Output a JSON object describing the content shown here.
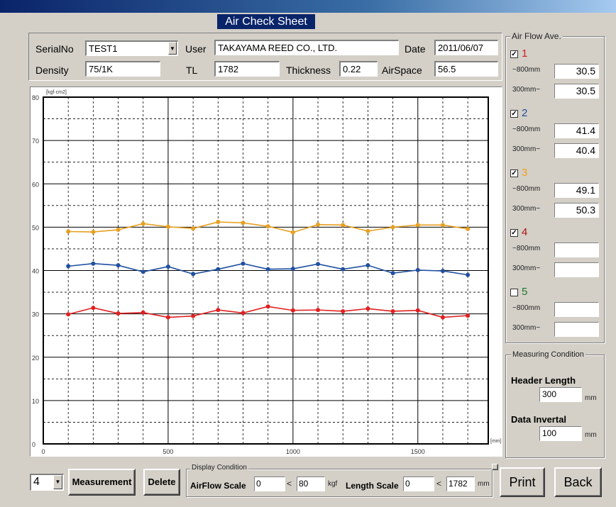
{
  "window": {
    "title": "Air Check Sheet"
  },
  "header": {
    "serial_label": "SerialNo",
    "serial_value": "TEST1",
    "user_label": "User",
    "user_value": "TAKAYAMA REED CO., LTD.",
    "date_label": "Date",
    "date_value": "2011/06/07",
    "density_label": "Density",
    "density_value": "75/1K",
    "tl_label": "TL",
    "tl_value": "1782",
    "thickness_label": "Thickness",
    "thickness_value": "0.22",
    "airspace_label": "AirSpace",
    "airspace_value": "56.5"
  },
  "airflow": {
    "title": "Air Flow Ave.",
    "row1_label": "~800mm",
    "row2_label": "300mm~",
    "groups": [
      {
        "num": "1",
        "checked": true,
        "color": "#d01c1c",
        "v1": "30.5",
        "v2": "30.5"
      },
      {
        "num": "2",
        "checked": true,
        "color": "#1f4ea0",
        "v1": "41.4",
        "v2": "40.4"
      },
      {
        "num": "3",
        "checked": true,
        "color": "#f0a020",
        "v1": "49.1",
        "v2": "50.3"
      },
      {
        "num": "4",
        "checked": true,
        "color": "#b01010",
        "v1": "",
        "v2": ""
      },
      {
        "num": "5",
        "checked": false,
        "color": "#1a7a2a",
        "v1": "",
        "v2": ""
      }
    ]
  },
  "measuring": {
    "title": "Measuring Condition",
    "header_length_label": "Header Length",
    "header_length_value": "300",
    "header_length_unit": "mm",
    "data_interval_label": "Data Invertal",
    "data_interval_value": "100",
    "data_interval_unit": "mm"
  },
  "bottom": {
    "count_value": "4",
    "measurement_label": "Measurement",
    "delete_label": "Delete",
    "display_title": "Display Condition",
    "airflow_scale_label": "AirFlow Scale",
    "airflow_min": "0",
    "airflow_max": "80",
    "airflow_unit": "kgf",
    "length_scale_label": "Length Scale",
    "length_min": "0",
    "length_max": "1782",
    "length_unit": "mm",
    "lt_sign": "<",
    "print_label": "Print",
    "back_label": "Back"
  },
  "chart_data": {
    "type": "line",
    "ylabel": "[kgf·cm2]",
    "xlabel": "[mm]",
    "xlim": [
      0,
      1782
    ],
    "ylim": [
      0,
      80
    ],
    "x_ticks": [
      0,
      500,
      1000,
      1500
    ],
    "y_ticks": [
      0,
      10,
      20,
      30,
      40,
      50,
      60,
      70,
      80
    ],
    "grid": true,
    "x": [
      100,
      200,
      300,
      400,
      500,
      600,
      700,
      800,
      900,
      1000,
      1100,
      1200,
      1300,
      1400,
      1500,
      1600,
      1700
    ],
    "series": [
      {
        "color": "#e8a020",
        "values": [
          49.0,
          48.9,
          49.4,
          50.8,
          50.1,
          49.7,
          51.2,
          51.0,
          50.2,
          48.8,
          50.6,
          50.5,
          49.1,
          50.0,
          50.5,
          50.5,
          49.6
        ]
      },
      {
        "color": "#2050a0",
        "values": [
          41.0,
          41.6,
          41.2,
          39.7,
          40.9,
          39.2,
          40.3,
          41.6,
          40.3,
          40.4,
          41.5,
          40.3,
          41.2,
          39.4,
          40.1,
          39.9,
          39.0
        ]
      },
      {
        "color": "#e02020",
        "values": [
          29.9,
          31.4,
          30.1,
          30.3,
          29.2,
          29.5,
          30.9,
          30.2,
          31.7,
          30.8,
          30.9,
          30.6,
          31.2,
          30.6,
          30.8,
          29.2,
          29.6
        ]
      }
    ]
  }
}
